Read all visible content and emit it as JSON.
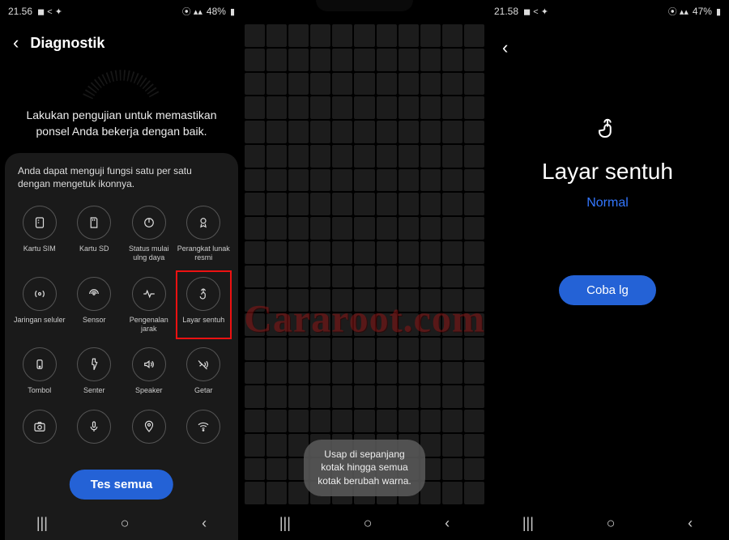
{
  "watermark": "Cararoot.com",
  "phone1": {
    "status": {
      "time": "21.56",
      "battery": "48%"
    },
    "title": "Diagnostik",
    "intro": "Lakukan pengujian untuk memastikan ponsel Anda bekerja dengan baik.",
    "panel_hint": "Anda dapat menguji fungsi satu per satu dengan mengetuk ikonnya.",
    "items": [
      {
        "id": "sim",
        "label": "Kartu SIM"
      },
      {
        "id": "sd",
        "label": "Kartu SD"
      },
      {
        "id": "power",
        "label": "Status mulai ulng daya"
      },
      {
        "id": "sw",
        "label": "Perangkat lunak resmi"
      },
      {
        "id": "cell",
        "label": "Jaringan seluler"
      },
      {
        "id": "sensor",
        "label": "Sensor"
      },
      {
        "id": "proximity",
        "label": "Pengenalan jarak"
      },
      {
        "id": "touch",
        "label": "Layar sentuh",
        "highlight": true
      },
      {
        "id": "button",
        "label": "Tombol"
      },
      {
        "id": "flash",
        "label": "Senter"
      },
      {
        "id": "speaker",
        "label": "Speaker"
      },
      {
        "id": "vibrate",
        "label": "Getar"
      },
      {
        "id": "camera",
        "label": ""
      },
      {
        "id": "mic",
        "label": ""
      },
      {
        "id": "location",
        "label": ""
      },
      {
        "id": "wifi",
        "label": ""
      }
    ],
    "primary_button": "Tes semua"
  },
  "phone2": {
    "status": {
      "time": "",
      "battery": ""
    },
    "toast": "Usap di sepanjang kotak hingga semua kotak berubah warna."
  },
  "phone3": {
    "status": {
      "time": "21.58",
      "battery": "47%"
    },
    "result_title": "Layar sentuh",
    "result_status": "Normal",
    "retry_button": "Coba lg"
  },
  "nav": {
    "recents": "|||",
    "home": "○",
    "back": "‹"
  }
}
